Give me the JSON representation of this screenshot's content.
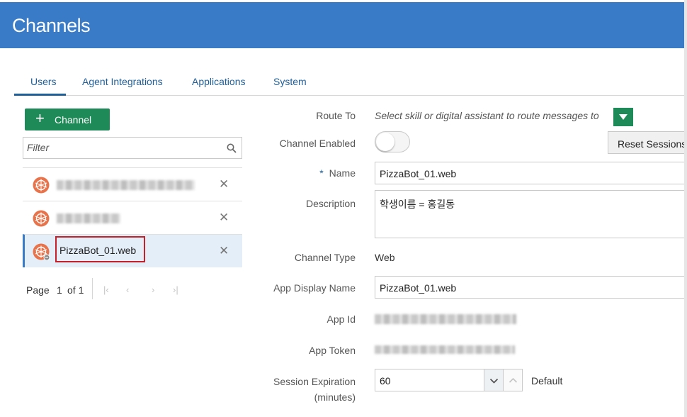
{
  "header": {
    "title": "Channels"
  },
  "tabs": [
    {
      "label": "Users"
    },
    {
      "label": "Agent Integrations"
    },
    {
      "label": "Applications"
    },
    {
      "label": "System"
    }
  ],
  "sidebar": {
    "add_button_label": "Channel",
    "filter_placeholder": "Filter",
    "items": [
      {
        "name": "",
        "redacted": true
      },
      {
        "name": "",
        "redacted": true
      },
      {
        "name": "PizzaBot_01.web",
        "selected": true
      }
    ],
    "pager": {
      "page_label": "Page",
      "page_number": "1",
      "of_label": "of 1"
    }
  },
  "form": {
    "route_to": {
      "label": "Route To",
      "placeholder": "Select skill or digital assistant to route messages to"
    },
    "channel_enabled": {
      "label": "Channel Enabled",
      "enabled": false
    },
    "reset_button_label": "Reset Sessions",
    "name": {
      "label": "Name",
      "required_mark": "*",
      "value": "PizzaBot_01.web"
    },
    "description": {
      "label": "Description",
      "value": "학생이름 = 홍길동"
    },
    "channel_type": {
      "label": "Channel Type",
      "value": "Web"
    },
    "app_display_name": {
      "label": "App Display Name",
      "value": "PizzaBot_01.web"
    },
    "app_id": {
      "label": "App Id",
      "redacted": true
    },
    "app_token": {
      "label": "App Token",
      "redacted": true
    },
    "session_expiration": {
      "label_line1": "Session Expiration",
      "label_line2": "(minutes)",
      "value": "60",
      "default_label": "Default"
    }
  },
  "colors": {
    "header": "#3a7bc8",
    "accent_green": "#1d8a57",
    "tab_text": "#1f5f99",
    "highlight_border": "#c4202a"
  }
}
